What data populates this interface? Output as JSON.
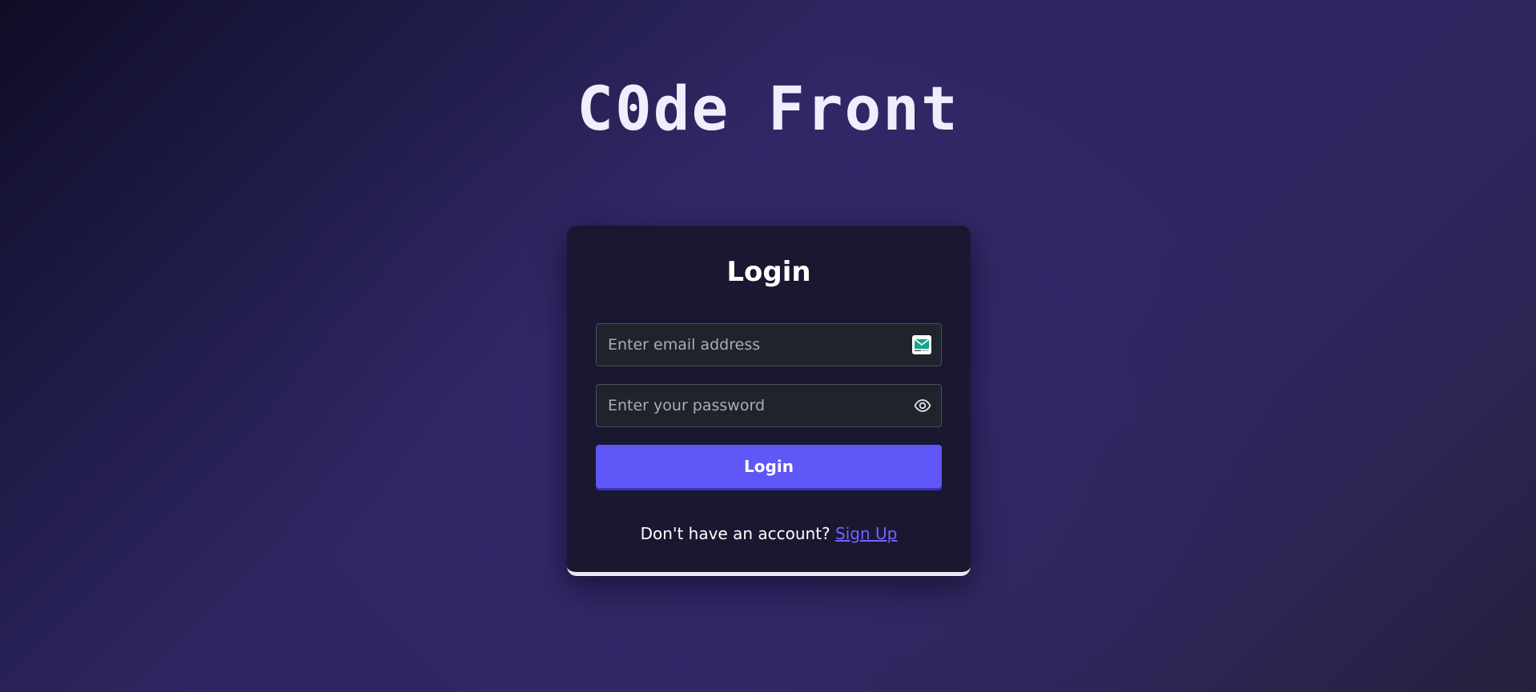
{
  "brand": {
    "title": "C0de Front"
  },
  "login_card": {
    "title": "Login",
    "email_field": {
      "placeholder": "Enter email address",
      "value": "",
      "icon": "mail-icon"
    },
    "password_field": {
      "placeholder": "Enter your password",
      "value": "",
      "icon": "eye-icon"
    },
    "login_button_label": "Login",
    "signup_prompt": "Don't have an account?",
    "signup_link_label": "Sign Up"
  },
  "colors": {
    "accent": "#5f57f8",
    "link": "#6e66ff",
    "card_background": "#1a1731",
    "field_background": "#1f232b",
    "page_background_mid": "#2f2763"
  }
}
